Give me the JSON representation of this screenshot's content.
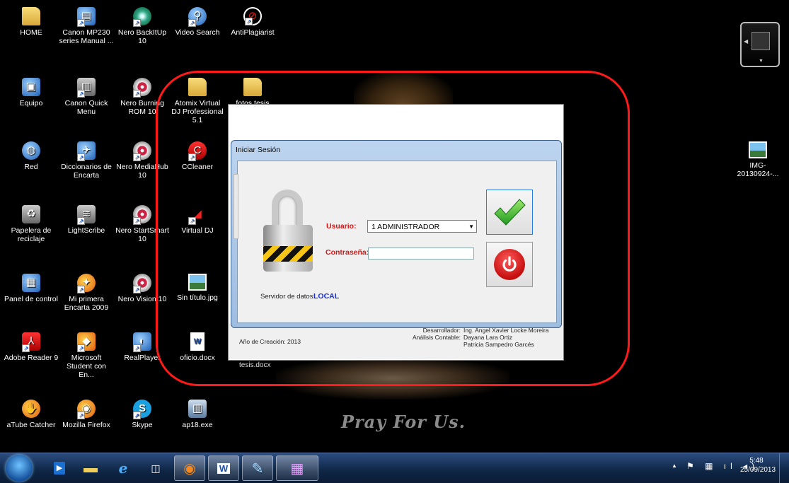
{
  "desktop": {
    "icons": [
      {
        "label": "HOME",
        "icon": "folder-user-icon"
      },
      {
        "label": "Canon MP230 series Manual ...",
        "icon": "manual-shortcut-icon"
      },
      {
        "label": "Nero BackItUp 10",
        "icon": "nero-backitup-icon"
      },
      {
        "label": "Video Search",
        "icon": "video-search-icon"
      },
      {
        "label": "AntiPlagiarist",
        "icon": "antiplagiarist-icon"
      },
      {
        "label": "Equipo",
        "icon": "computer-icon"
      },
      {
        "label": "Canon Quick Menu",
        "icon": "canon-quick-menu-icon"
      },
      {
        "label": "Nero Burning ROM 10",
        "icon": "nero-burning-rom-icon"
      },
      {
        "label": "Atomix Virtual DJ Professional 5.1",
        "icon": "folder-icon"
      },
      {
        "label": "fotos tesis",
        "icon": "folder-icon"
      },
      {
        "label": "Red",
        "icon": "network-icon"
      },
      {
        "label": "Diccionarios de Encarta",
        "icon": "encarta-dictionary-icon"
      },
      {
        "label": "Nero MediaHub 10",
        "icon": "nero-mediahub-icon"
      },
      {
        "label": "CCleaner",
        "icon": "ccleaner-icon"
      },
      {
        "label": "IMG-20130924-...",
        "icon": "image-file-icon"
      },
      {
        "label": "Papelera de reciclaje",
        "icon": "recycle-bin-icon"
      },
      {
        "label": "LightScribe",
        "icon": "lightscribe-icon"
      },
      {
        "label": "Nero StartSmart 10",
        "icon": "nero-startsmart-icon"
      },
      {
        "label": "Virtual DJ",
        "icon": "virtual-dj-icon"
      },
      {
        "label": "Panel de control",
        "icon": "control-panel-icon"
      },
      {
        "label": "Mi primera Encarta 2009",
        "icon": "encarta-icon"
      },
      {
        "label": "Nero Vision 10",
        "icon": "nero-vision-icon"
      },
      {
        "label": "Sin título.jpg",
        "icon": "image-file-icon"
      },
      {
        "label": "Adobe Reader 9",
        "icon": "adobe-reader-icon"
      },
      {
        "label": "Microsoft Student con En...",
        "icon": "microsoft-student-icon"
      },
      {
        "label": "RealPlayer",
        "icon": "realplayer-icon"
      },
      {
        "label": "oficio.docx",
        "icon": "word-document-icon"
      },
      {
        "label": "aTube Catcher",
        "icon": "atube-catcher-icon"
      },
      {
        "label": "Mozilla Firefox",
        "icon": "firefox-icon"
      },
      {
        "label": "Skype",
        "icon": "skype-icon"
      },
      {
        "label": "ap18.exe",
        "icon": "setup-exe-icon"
      }
    ],
    "partially_hidden_label": "tesis.docx",
    "wallpaper_text": "Pray For Us."
  },
  "login_dialog": {
    "title": "Iniciar Sesión",
    "user_label": "Usuario:",
    "user_value": "1  ADMINISTRADOR",
    "password_label": "Contraseña:",
    "password_value": "",
    "server_label": "Servidor de datos:",
    "server_value": "LOCAL",
    "accept_icon": "green-check-icon",
    "exit_icon": "power-icon"
  },
  "main_window": {
    "year_text": "Año de Creación: 2013",
    "developer_key": "Desarrollador:",
    "developer_value": "Ing. Angel Xavier Locke Moreira",
    "accounting_key": "Análisis Contable:",
    "accounting_value_1": "Dayana Lara Ortiz",
    "accounting_value_2": "Patricia Sampedro Garcés"
  },
  "taskbar": {
    "buttons": [
      "media-player-icon",
      "file-explorer-icon",
      "internet-explorer-icon",
      "windows-mobility-icon",
      "firefox-icon",
      "word-icon",
      "paint-icon",
      "app-window-icon"
    ],
    "time": "5:48",
    "date": "25/09/2013"
  },
  "colors": {
    "highlight_ring": "#ff1a1a",
    "field_label": "#d81616",
    "server_value": "#1830d0"
  }
}
